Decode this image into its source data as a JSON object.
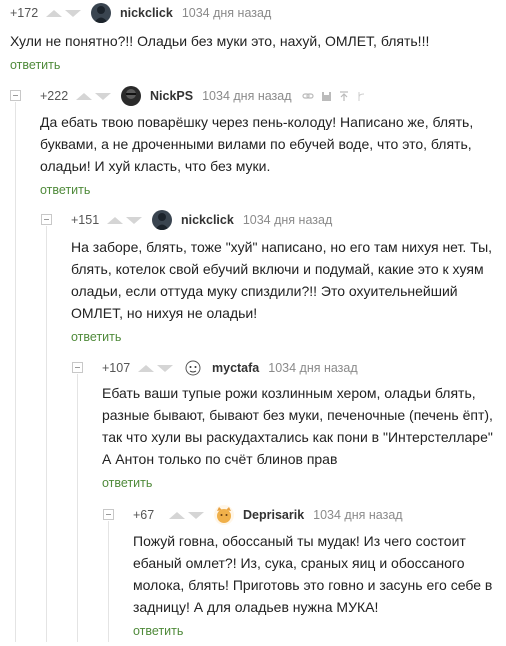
{
  "comments": [
    {
      "rating": "+172",
      "user": "nickclick",
      "time": "1034 дня назад",
      "lines": [
        "Хули не понятно?!! Оладьи без муки это, нахуй, ОМЛЕТ, блять!!!"
      ],
      "reply": "ответить",
      "avatar": "dark-figure-avatar"
    },
    {
      "rating": "+222",
      "user": "NickPS",
      "time": "1034 дня назад",
      "lines": [
        "Да ебать твою поварёшку через пень-колоду! Написано же, блять,",
        "буквами, а не дроченными вилами по ебучей воде, что это, блять,",
        "оладьи! И хуй класть, что без муки."
      ],
      "reply": "ответить",
      "avatar": "dark-face-avatar"
    },
    {
      "rating": "+151",
      "user": "nickclick",
      "time": "1034 дня назад",
      "lines": [
        "На заборе, блять, тоже \"хуй\" написано, но его там нихуя нет. Ты,",
        "блять, котелок свой ебучий включи и подумай, какие это к хуям",
        "оладьи, если оттуда муку спиздили?!! Это охуительнейший",
        "ОМЛЕТ, но нихуя не оладьи!"
      ],
      "reply": "ответить",
      "avatar": "dark-figure-avatar"
    },
    {
      "rating": "+107",
      "user": "myctafa",
      "time": "1034 дня назад",
      "lines": [
        "Ебать ваши тупые рожи козлинным хером, оладьи блять,",
        "разные бывают, бывают без муки, печеночные (печень ёпт),",
        "так что хули вы раскудахтались как пони в \"Интерстелларе\"",
        "А Антон только по счёт блинов прав"
      ],
      "reply": "ответить",
      "avatar": "sketch-face-avatar"
    },
    {
      "rating": "+67",
      "user": "Deprisarik",
      "time": "1034 дня назад",
      "lines": [
        "Пожуй говна, обоссаный ты мудак! Из чего состоит",
        "ебаный омлет?! Из, сука, сраных яиц и обоссаного",
        "молока, блять! Приготовь это говно и засунь его себе в",
        "задницу! А для оладьев нужна МУКА!"
      ],
      "reply": "ответить",
      "avatar": "orange-cat-avatar"
    }
  ],
  "colors": {
    "reply_link": "#4f8a3a",
    "muted": "#8a8a8a",
    "thread_line": "#e4e4e4"
  }
}
